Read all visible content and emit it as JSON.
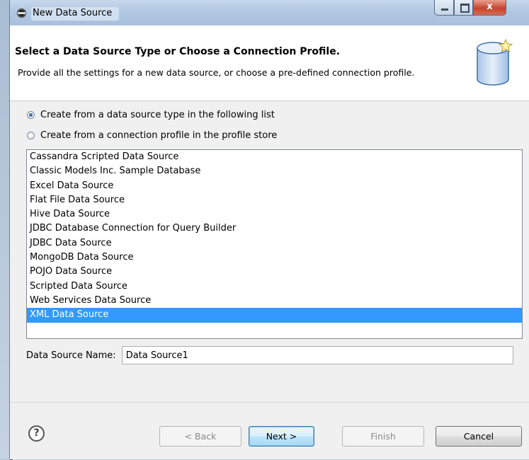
{
  "window": {
    "title": "New Data Source"
  },
  "header": {
    "heading": "Select a Data Source Type or Choose a Connection Profile.",
    "description": "Provide all the settings for a new data source, or choose a pre-defined connection profile."
  },
  "options": {
    "create_from_type": {
      "label": "Create from a data source type in the following list",
      "checked": true
    },
    "create_from_profile": {
      "label": "Create from a connection profile in the profile store",
      "checked": false
    }
  },
  "data_source_types": {
    "items": [
      "Cassandra Scripted Data Source",
      "Classic Models Inc. Sample Database",
      "Excel Data Source",
      "Flat File Data Source",
      "Hive Data Source",
      "JDBC Database Connection for Query Builder",
      "JDBC Data Source",
      "MongoDB Data Source",
      "POJO Data Source",
      "Scripted Data Source",
      "Web Services Data Source",
      "XML Data Source"
    ],
    "selected": "XML Data Source"
  },
  "name_field": {
    "label": "Data Source Name:",
    "value": "Data Source1"
  },
  "buttons": {
    "help": "?",
    "back": "< Back",
    "next": "Next >",
    "finish": "Finish",
    "cancel": "Cancel"
  },
  "window_controls": {
    "close": "x"
  },
  "colors": {
    "selection": "#3399ff",
    "titlebar": "#b1c8e2"
  }
}
